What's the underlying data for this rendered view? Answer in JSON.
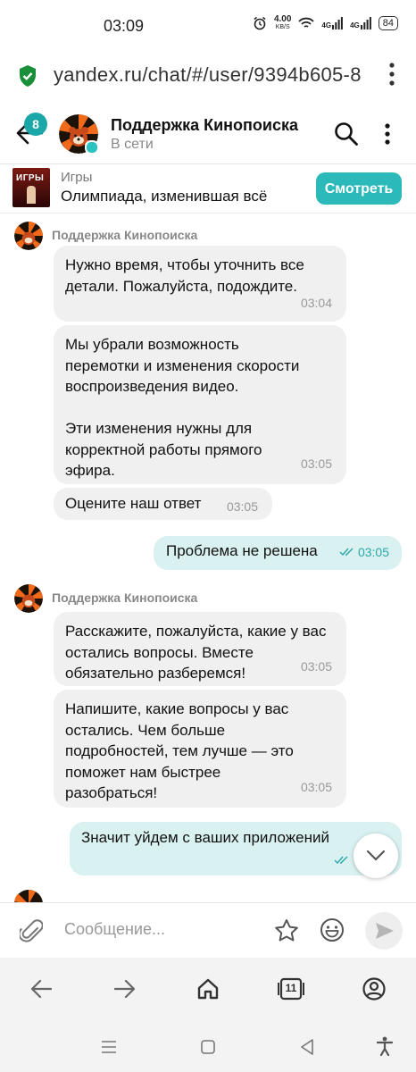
{
  "status_bar": {
    "time": "03:09",
    "net_speed_value": "4.00",
    "net_speed_unit": "KB/S",
    "net_type1": "4G",
    "net_type2": "4G",
    "battery": "84"
  },
  "browser": {
    "url": "yandex.ru/chat/#/user/9394b605-8",
    "tabs_count": "11"
  },
  "chat": {
    "unread_badge": "8",
    "title": "Поддержка Кинопоиска",
    "presence": "В сети"
  },
  "promo": {
    "category": "Игры",
    "thumb_text": "ИГРЫ",
    "title": "Олимпиада, изменившая всё",
    "button": "Смотреть"
  },
  "messages": {
    "sender_name": "Поддержка Кинопоиска",
    "m1": {
      "text": "Нужно время, чтобы уточнить все детали. Пожалуйста, подождите.",
      "time": "03:04"
    },
    "m2": {
      "text": "Мы убрали возможность перемотки и изменения скорости воспроизведения видео.\n\nЭти изменения нужны для корректной работы прямого эфира.",
      "time": "03:05"
    },
    "m3": {
      "text": "Оцените наш ответ",
      "time": "03:05"
    },
    "o1": {
      "text": "Проблема не решена",
      "time": "03:05"
    },
    "m4": {
      "text": "Расскажите, пожалуйста, какие у вас остались вопросы. Вместе обязательно разберемся!",
      "time": "03:05"
    },
    "m5": {
      "text": "Напишите, какие вопросы у вас остались. Чем больше подробностей, тем лучше — это поможет нам быстрее разобраться!",
      "time": "03:05"
    },
    "o2": {
      "text": "Значит уйдем с ваших приложений"
    }
  },
  "composer": {
    "placeholder": "Сообщение..."
  },
  "colors": {
    "accent": "#2bb9b9",
    "bubble_in": "#f0f0f0",
    "bubble_out": "#d9f1f1",
    "badge": "#19a7a7"
  }
}
